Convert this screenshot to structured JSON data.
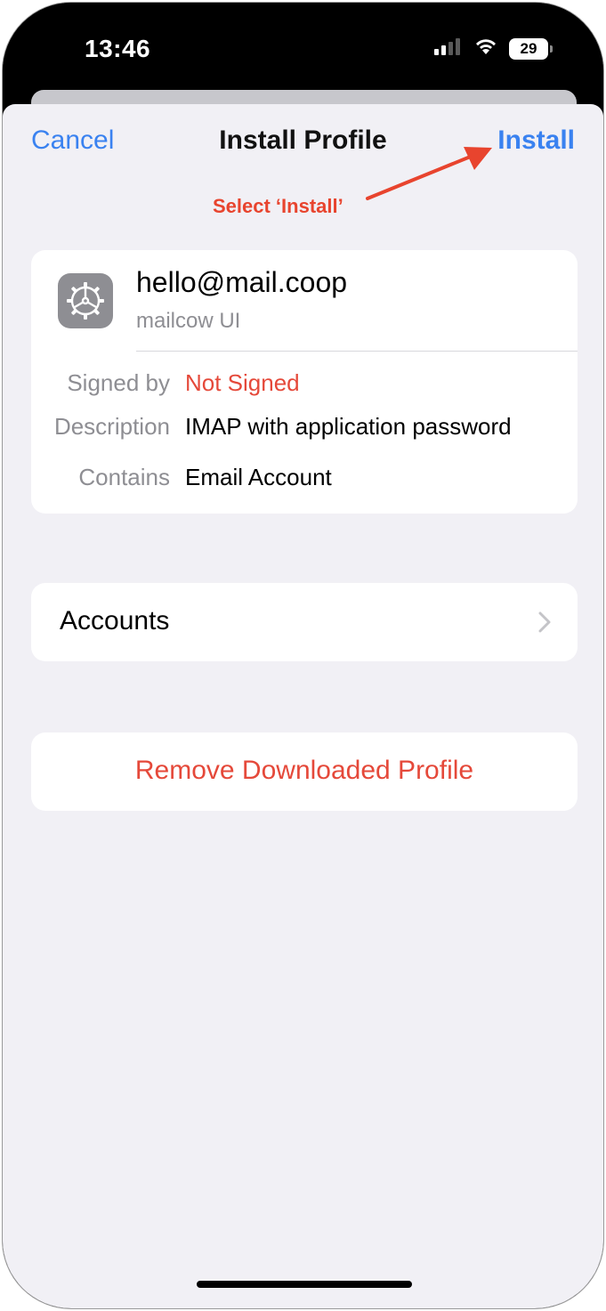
{
  "status_bar": {
    "time": "13:46",
    "battery": "29",
    "icons": [
      "cellular-signal-icon",
      "wifi-icon",
      "battery-icon"
    ]
  },
  "nav": {
    "cancel": "Cancel",
    "title": "Install Profile",
    "install": "Install"
  },
  "annotation": {
    "text": "Select ‘Install’",
    "color": "#e8442e"
  },
  "profile": {
    "icon": "settings-gear-icon",
    "name": "hello@mail.coop",
    "subtitle": "mailcow UI",
    "details": [
      {
        "label": "Signed by",
        "value": "Not Signed"
      },
      {
        "label": "Description",
        "value": "IMAP with application password"
      },
      {
        "label": "Contains",
        "value": "Email Account"
      }
    ]
  },
  "accounts": {
    "label": "Accounts"
  },
  "remove": {
    "label": "Remove Downloaded Profile"
  },
  "colors": {
    "accent_blue": "#3a82f0",
    "destructive_red": "#e5493a",
    "background": "#f1f0f5"
  }
}
